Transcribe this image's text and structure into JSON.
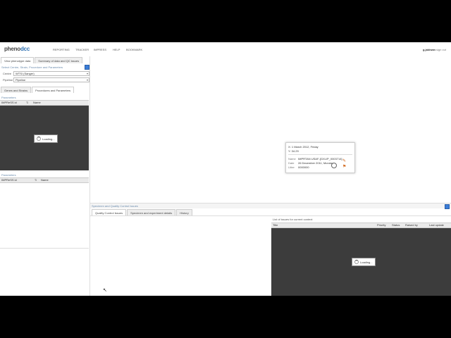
{
  "topbar": {
    "logo_main": "pheno",
    "logo_accent": "dcc",
    "nav": [
      "REPORTING",
      "TRACKER",
      "IMPRESS",
      "HELP",
      "BOOKMARK"
    ],
    "user": "g.jakiwan",
    "signout": "sign out"
  },
  "left": {
    "tabs": [
      "View phenotype data",
      "Summary of data and QC issues"
    ],
    "filter_label": "Select Centre, Strain, Procedure and Parameters",
    "centre_label": "Centre",
    "centre_value": "WTSI (Sanger)",
    "pipeline_label": "Pipeline",
    "pipeline_value": "Pipeline",
    "subtabs": [
      "Genes and Strains",
      "Procedures and Parameters"
    ],
    "parameters_label": "Parameters",
    "grid1_cols": [
      "IMPReSS id",
      "Name"
    ],
    "loading_text": "Loading...",
    "grid2_label": "Parameters",
    "grid2_cols": [
      "IMPReSS id",
      "Name"
    ]
  },
  "popup": {
    "x_line": "X: 1 March 2012, Friday",
    "y_line": "Y: 34.29",
    "name_label": "Name",
    "name_value": "IMPRTAN USAF-[GXLIP_0003714]",
    "date_label": "Date",
    "date_value": "26 December 2011, Monday",
    "litter_label": "Litter",
    "litter_value": "0000000"
  },
  "bottom": {
    "header": "Specimen and Quality Control Issues",
    "tabs": [
      "Quality Control Issues",
      "Specimen and experiment details",
      "History"
    ],
    "issues_title": "List of issues for current context",
    "cols": [
      "Title",
      "Priority",
      "Status",
      "Raised by",
      "Last update"
    ],
    "loading_text": "Loading..."
  },
  "colors": {
    "accent": "#3b7dd8",
    "dark_grid": "#3c3c3c"
  }
}
